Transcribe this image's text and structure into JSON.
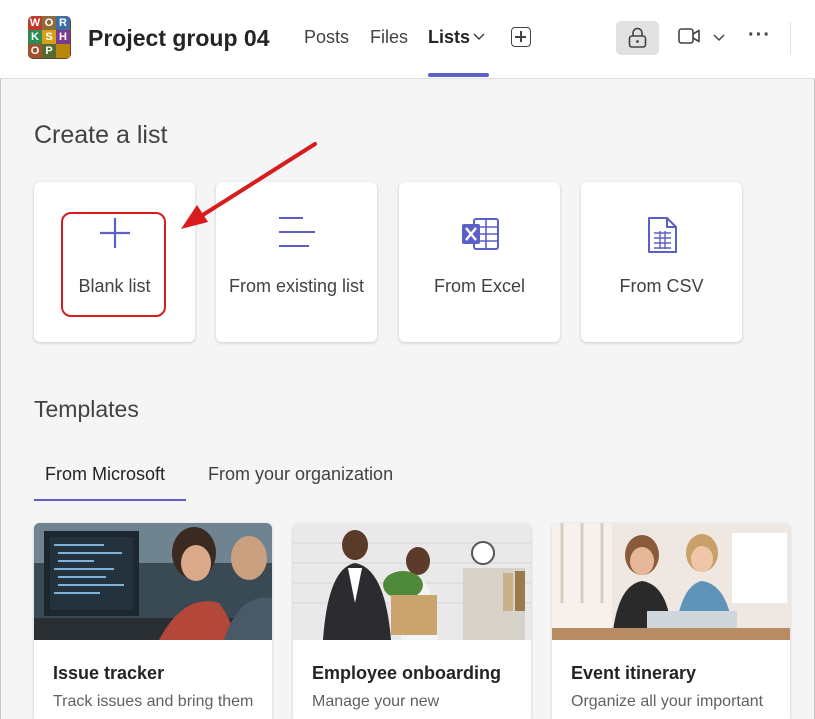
{
  "header": {
    "avatar_letters": [
      "W",
      "O",
      "R",
      "K",
      "S",
      "H",
      "O",
      "P",
      ""
    ],
    "title": "Project group 04",
    "tabs": [
      {
        "label": "Posts"
      },
      {
        "label": "Files"
      },
      {
        "label": "Lists"
      }
    ],
    "more_label": "···"
  },
  "create": {
    "heading": "Create a list",
    "cards": [
      {
        "label": "Blank list",
        "icon": "plus-icon"
      },
      {
        "label": "From existing list",
        "icon": "list-lines-icon"
      },
      {
        "label": "From Excel",
        "icon": "excel-icon"
      },
      {
        "label": "From CSV",
        "icon": "csv-icon"
      }
    ]
  },
  "templates": {
    "heading": "Templates",
    "tabs": [
      {
        "label": "From Microsoft"
      },
      {
        "label": "From your organization"
      }
    ],
    "cards": [
      {
        "name": "Issue tracker",
        "desc": "Track issues and bring them"
      },
      {
        "name": "Employee onboarding",
        "desc": "Manage your new"
      },
      {
        "name": "Event itinerary",
        "desc": "Organize all your important"
      }
    ]
  },
  "colors": {
    "accent": "#5b5fc7",
    "annotation": "#d61c1c"
  }
}
